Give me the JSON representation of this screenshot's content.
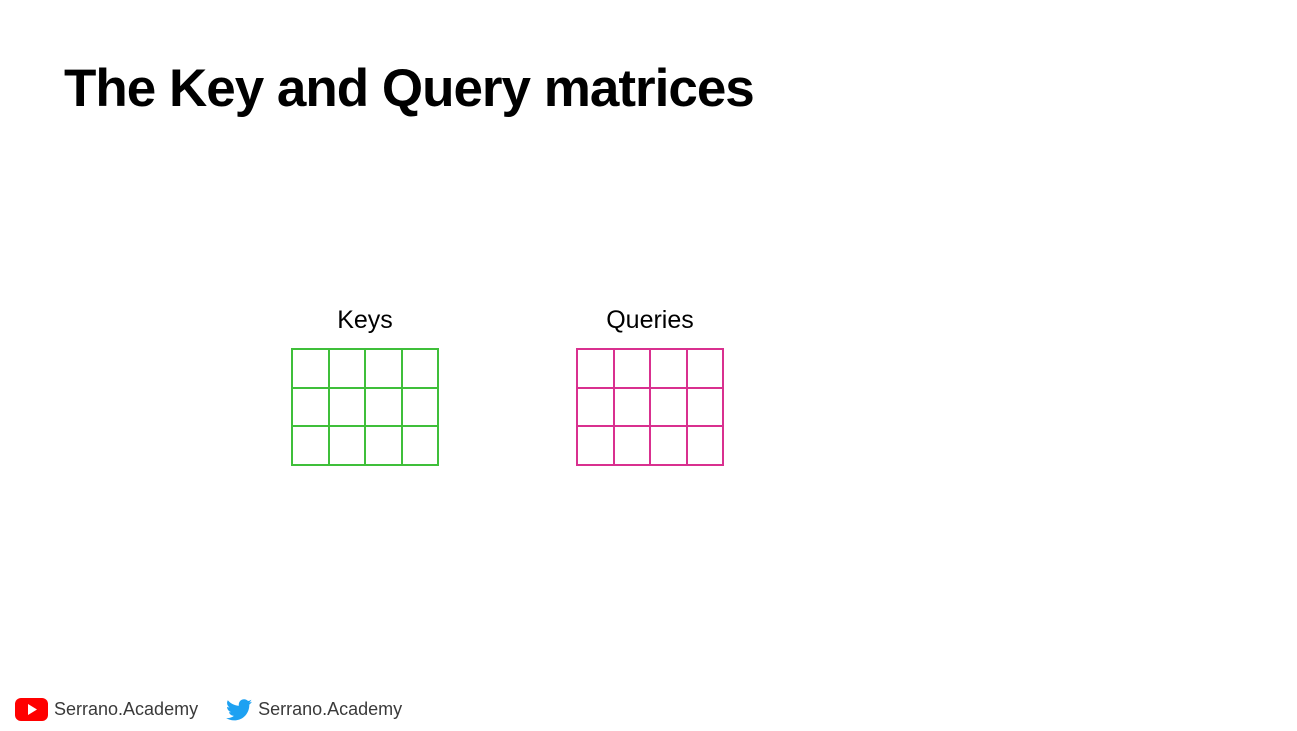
{
  "slide": {
    "title": "The Key and Query matrices"
  },
  "matrices": [
    {
      "label": "Keys",
      "rows": 3,
      "cols": 4,
      "color": "#3fbf3a"
    },
    {
      "label": "Queries",
      "rows": 3,
      "cols": 4,
      "color": "#d9308f"
    }
  ],
  "footer": {
    "youtube": {
      "icon": "youtube-icon",
      "handle": "Serrano.Academy",
      "color": "#ff0000"
    },
    "twitter": {
      "icon": "twitter-icon",
      "handle": "Serrano.Academy",
      "color": "#1da1f2"
    }
  }
}
